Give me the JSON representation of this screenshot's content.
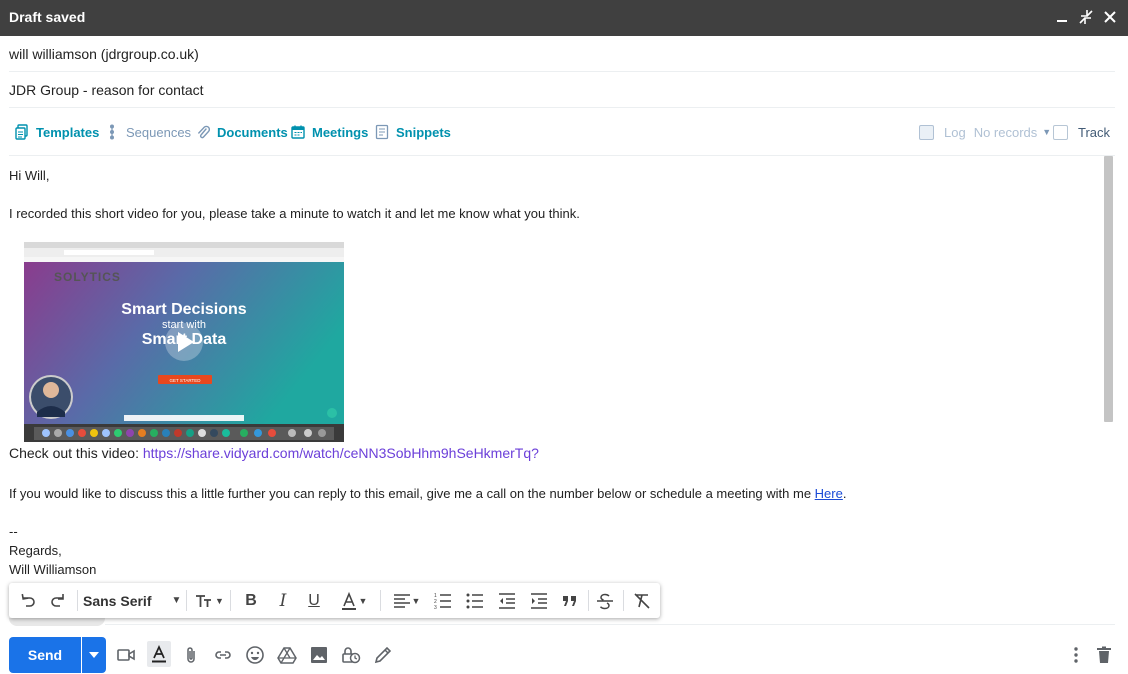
{
  "window": {
    "title": "Draft saved"
  },
  "compose": {
    "to": "will williamson (jdrgroup.co.uk)",
    "subject": "JDR Group - reason for contact"
  },
  "hubspot": {
    "templates": "Templates",
    "sequences": "Sequences",
    "documents": "Documents",
    "meetings": "Meetings",
    "snippets": "Snippets",
    "log": "Log",
    "no_records": "No records",
    "track": "Track",
    "accent": "#0091ae"
  },
  "email": {
    "greeting": "Hi Will,",
    "intro": "I recorded this short video for you, please take a minute to watch it and let me know what you think.",
    "video": {
      "brand": "SOLYTICS",
      "headline_1": "Smart Decisions",
      "headline_2": "start with",
      "headline_3": "Smart Data",
      "cta": "GET STARTED"
    },
    "check_out": "Check out this video: ",
    "video_link": "https://share.vidyard.com/watch/ceNN3SobHhm9hSeHkmerTq?",
    "followup": "If you would like to discuss this a little further you can reply to this email, give me a call on the number below or schedule a meeting with me ",
    "here_link": "Here",
    "followup_end": ".",
    "dashes": "--",
    "regards": "Regards,",
    "name": "Will Williamson"
  },
  "format_toolbar": {
    "font": "Sans Serif"
  },
  "bottom": {
    "send": "Send",
    "send_color": "#1a73e8"
  }
}
